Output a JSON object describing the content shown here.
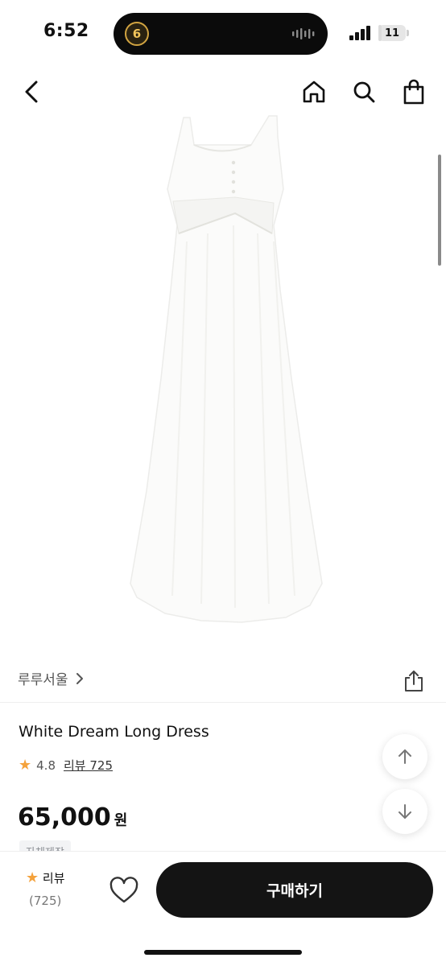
{
  "status_bar": {
    "time": "6:52",
    "battery": "11",
    "battery_level": 0.11,
    "app_badge": "6"
  },
  "nav": {
    "back_icon": "chevron-left-icon",
    "home_icon": "home-icon",
    "search_icon": "search-icon",
    "cart_icon": "shopping-bag-icon"
  },
  "product": {
    "brand": "루루서울",
    "name": "White Dream Long Dress",
    "rating": "4.8",
    "review_label": "리뷰 725",
    "price": "65,000",
    "currency": "원",
    "tag": "자체제작"
  },
  "bottom_bar": {
    "review_label": "리뷰",
    "review_count": "(725)",
    "buy_label": "구매하기"
  },
  "colors": {
    "accent_star": "#f4a23c",
    "buy_button": "#141414"
  }
}
